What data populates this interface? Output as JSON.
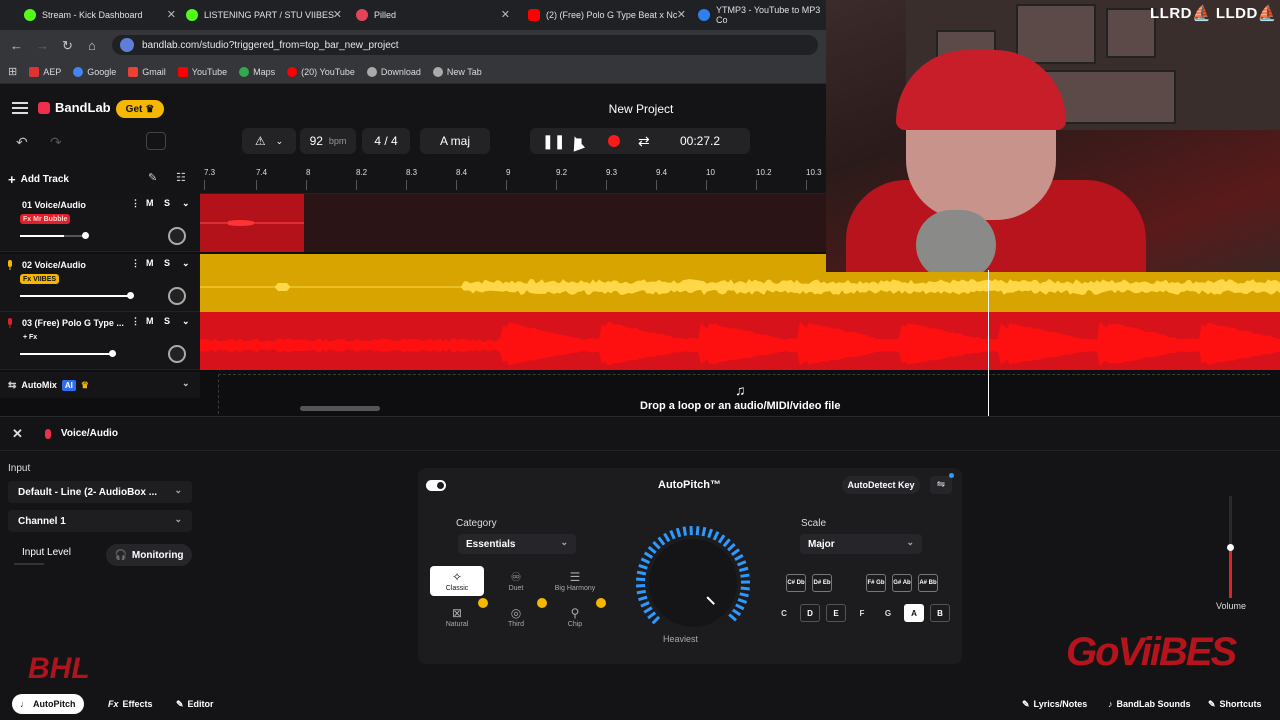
{
  "browser": {
    "tabs": [
      {
        "title": "Stream - Kick Dashboard",
        "color": "#53fc18"
      },
      {
        "title": "LISTENING PART / STU VIIBES",
        "color": "#53fc18"
      },
      {
        "title": "Pilled",
        "color": "#e2455b"
      },
      {
        "title": "(2) (Free) Polo G Type Beat x Nc",
        "color": "#ff0000"
      },
      {
        "title": "YTMP3 - YouTube to MP3 Co",
        "color": "#2e7ff0"
      }
    ],
    "url": "bandlab.com/studio?triggered_from=top_bar_new_project",
    "bookmarks": [
      {
        "label": "AEP",
        "color": "#d33"
      },
      {
        "label": "Google",
        "color": "#4285f4"
      },
      {
        "label": "Gmail",
        "color": "#ea4335"
      },
      {
        "label": "YouTube",
        "color": "#ff0000"
      },
      {
        "label": "Maps",
        "color": "#34a853"
      },
      {
        "label": "(20) YouTube",
        "color": "#ff0000"
      },
      {
        "label": "Download",
        "color": "#aaaaaa"
      },
      {
        "label": "New Tab",
        "color": "#aaaaaa"
      }
    ]
  },
  "app": {
    "brand": "BandLab",
    "get_label": "Get",
    "project_title": "New Project",
    "tempo_value": "92",
    "tempo_unit": "bpm",
    "time_signature": "4 / 4",
    "key": "A maj",
    "time_display": "00:27.2",
    "add_track_label": "Add Track"
  },
  "ruler": {
    "ticks": [
      "7.3",
      "7.4",
      "8",
      "8.2",
      "8.3",
      "8.4",
      "9",
      "9.2",
      "9.3",
      "9.4",
      "10",
      "10.2",
      "10.3"
    ]
  },
  "tracks": [
    {
      "name": "01  Voice/Audio",
      "tag": "Fx Mr Bubble",
      "tag_bg": "#e0202a",
      "tag_color": "#ffd0d0",
      "volume": 0.67,
      "color": "#e0202a"
    },
    {
      "name": "02  Voice/Audio",
      "tag": "Fx VIIBES",
      "tag_bg": "#f5b700",
      "tag_color": "#111111",
      "volume": 0.92,
      "color": "#f5b700"
    },
    {
      "name": "03  (Free) Polo G Type ...",
      "tag": "+ Fx",
      "tag_bg": "transparent",
      "tag_color": "#ffffff",
      "volume": 0.8,
      "color": "#e0202a"
    }
  ],
  "track_buttons": {
    "mute": "M",
    "solo": "S"
  },
  "automix": {
    "label": "AutoMix",
    "ai": "AI"
  },
  "drop_text": "Drop a loop or an audio/MIDI/video file",
  "panel": {
    "track_title": "Voice/Audio",
    "input_heading": "Input",
    "input_device": "Default - Line (2- AudioBox ...",
    "channel": "Channel 1",
    "input_level_label": "Input Level",
    "monitoring_label": "Monitoring",
    "volume_label": "Volume",
    "volume_value": 0.5
  },
  "autopitch": {
    "title": "AutoPitch™",
    "autodetect_label": "AutoDetect Key",
    "category_label": "Category",
    "category_value": "Essentials",
    "scale_label": "Scale",
    "scale_value": "Major",
    "knob_label": "Heaviest",
    "knob_value": 1.0,
    "presets": [
      {
        "label": "Classic",
        "icon": "✧",
        "active": true,
        "premium": false
      },
      {
        "label": "Duet",
        "icon": "♾",
        "active": false,
        "premium": false
      },
      {
        "label": "Big Harmony",
        "icon": "☰",
        "active": false,
        "premium": false
      },
      {
        "label": "Natural",
        "icon": "⊠",
        "active": false,
        "premium": true
      },
      {
        "label": "Third",
        "icon": "◎",
        "active": false,
        "premium": true
      },
      {
        "label": "Chip",
        "icon": "⚲",
        "active": false,
        "premium": true
      }
    ],
    "sharps": [
      "C# Db",
      "D# Eb",
      "F# Gb",
      "G# Ab",
      "A# Bb"
    ],
    "naturals": [
      {
        "label": "C",
        "state": "off"
      },
      {
        "label": "D",
        "state": "nat"
      },
      {
        "label": "E",
        "state": "nat"
      },
      {
        "label": "F",
        "state": "off"
      },
      {
        "label": "G",
        "state": "off"
      },
      {
        "label": "A",
        "state": "on"
      },
      {
        "label": "B",
        "state": "nat"
      }
    ]
  },
  "bottom_toolbar": {
    "autopitch": "AutoPitch",
    "effects": "Effects",
    "editor": "Editor",
    "lyrics": "Lyrics/Notes",
    "sounds": "BandLab Sounds",
    "shortcuts": "Shortcuts"
  },
  "overlay": {
    "channel_tag": "LLRD⛵ LLDD⛵",
    "watermark": "GoViiBES",
    "watermark2": "BHL"
  }
}
